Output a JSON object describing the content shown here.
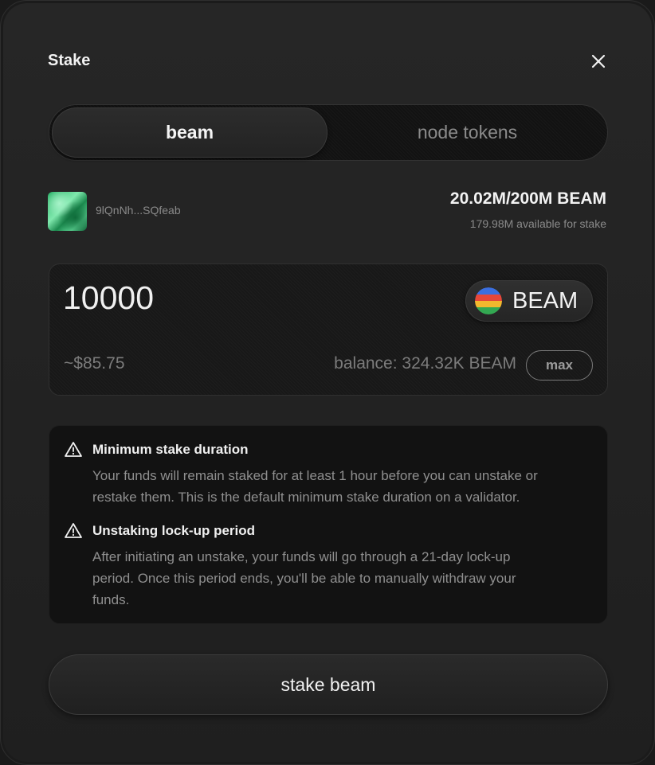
{
  "modal": {
    "title": "Stake",
    "close_icon": "close-icon"
  },
  "tabs": [
    {
      "label": "beam",
      "active": true
    },
    {
      "label": "node tokens",
      "active": false
    }
  ],
  "account": {
    "address": "9lQnNh...SQfeab",
    "avatar_icon": "account-avatar"
  },
  "stake_info": {
    "total": "20.02M/200M BEAM",
    "available": "179.98M available for stake"
  },
  "amount": {
    "value": "10000",
    "usd_value": "~$85.75",
    "balance": "balance: 324.32K BEAM",
    "max_label": "max"
  },
  "token": {
    "label": "BEAM",
    "icon": "beam-token-icon",
    "icon_colors": [
      "#3b6fe0",
      "#e6473a",
      "#f2b82e",
      "#33a852"
    ]
  },
  "notices": [
    {
      "icon": "warning-icon",
      "title": "Minimum stake duration",
      "lines": [
        "Your funds will remain staked for at least 1 hour before you can unstake or",
        "restake them. This is the default minimum stake duration on a validator."
      ]
    },
    {
      "icon": "warning-icon",
      "title": "Unstaking lock-up period",
      "lines": [
        "After initiating an unstake, your funds will go through a 21-day lock-up",
        "period. Once this period ends, you'll be able to manually withdraw your",
        "funds."
      ]
    }
  ],
  "actions": {
    "stake_label": "stake beam"
  }
}
